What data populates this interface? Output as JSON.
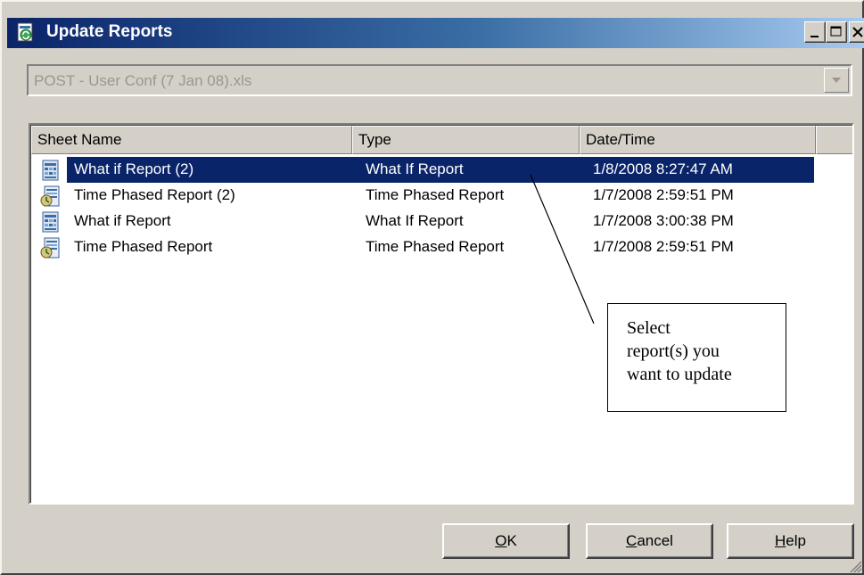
{
  "window": {
    "title": "Update Reports",
    "icon": "update-reports-app-icon",
    "controls": [
      "minimize-icon",
      "maximize-icon",
      "close-icon"
    ]
  },
  "workbook_select": {
    "value": "POST - User Conf (7 Jan 08).xls",
    "disabled": true
  },
  "list": {
    "columns": [
      "Sheet Name",
      "Type",
      "Date/Time"
    ],
    "rows": [
      {
        "name": "What if Report (2)",
        "type": "What If Report",
        "datetime": "1/8/2008 8:27:47 AM",
        "icon": "what-if-report-icon",
        "selected": true
      },
      {
        "name": "Time Phased Report (2)",
        "type": "Time Phased Report",
        "datetime": "1/7/2008 2:59:51 PM",
        "icon": "time-phased-report-icon",
        "selected": false
      },
      {
        "name": "What if Report",
        "type": "What If Report",
        "datetime": "1/7/2008 3:00:38 PM",
        "icon": "what-if-report-icon",
        "selected": false
      },
      {
        "name": "Time Phased Report",
        "type": "Time Phased Report",
        "datetime": "1/7/2008 2:59:51 PM",
        "icon": "time-phased-report-icon",
        "selected": false
      }
    ]
  },
  "buttons": {
    "ok": {
      "mnemonic": "O",
      "rest": "K"
    },
    "cancel": {
      "mnemonic": "C",
      "rest": "ancel"
    },
    "help": {
      "mnemonic": "H",
      "rest": "elp"
    }
  },
  "callout": {
    "lines": [
      "Select",
      "report(s) you",
      "want to update"
    ]
  },
  "colors": {
    "title_gradient_start": "#0a246a",
    "title_gradient_end": "#a6caf0",
    "selection": "#0a246a",
    "dialog_face": "#d4d0c8"
  }
}
